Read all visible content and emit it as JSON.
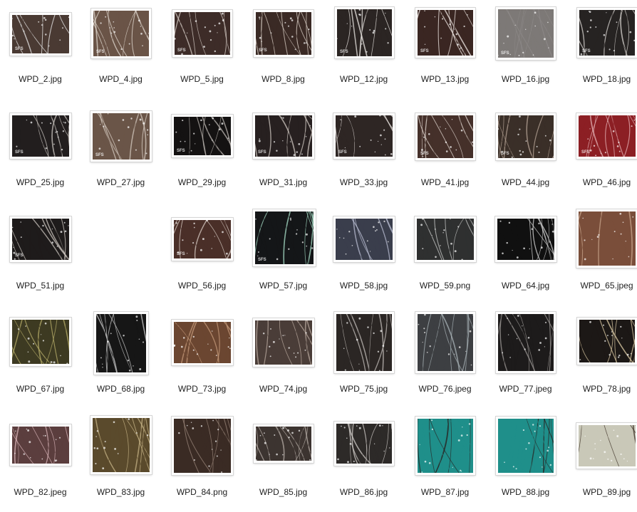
{
  "files": [
    {
      "name": "WPD_2.jpg",
      "watermark": "SFS",
      "base": "#4a3a33",
      "hi": "#e8e8e8"
    },
    {
      "name": "WPD_4.jpg",
      "watermark": "SFS",
      "base": "#6a5447",
      "hi": "#e2dad0"
    },
    {
      "name": "WPD_5.jpg",
      "watermark": "SFS",
      "base": "#3d2c28",
      "hi": "#d8cfc8"
    },
    {
      "name": "WPD_8.jpg",
      "watermark": "SFS",
      "base": "#3a2a25",
      "hi": "#e0d6cc"
    },
    {
      "name": "WPD_12.jpg",
      "watermark": "SFS",
      "base": "#2b2523",
      "hi": "#ece8e4"
    },
    {
      "name": "WPD_13.jpg",
      "watermark": "SFS",
      "base": "#3a2622",
      "hi": "#f0e8e4"
    },
    {
      "name": "WPD_16.jpg",
      "watermark": "SFS",
      "base": "#7d7977",
      "hi": "#8e8a88"
    },
    {
      "name": "WPD_18.jpg",
      "watermark": "SFS",
      "base": "#262322",
      "hi": "#d9d6d2"
    },
    {
      "name": "WPD_25.jpg",
      "watermark": "SFS",
      "base": "#221e1e",
      "hi": "#cfc9c4"
    },
    {
      "name": "WPD_27.jpg",
      "watermark": "SFS",
      "base": "#6a5548",
      "hi": "#d6cbc0"
    },
    {
      "name": "WPD_29.jpg",
      "watermark": "SFS",
      "base": "#141212",
      "hi": "#bfbab4"
    },
    {
      "name": "WPD_31.jpg",
      "watermark": "SFS",
      "base": "#272020",
      "hi": "#d0c8c2"
    },
    {
      "name": "WPD_33.jpg",
      "watermark": "SFS",
      "base": "#2e2624",
      "hi": "#e6e0dc"
    },
    {
      "name": "WPD_41.jpg",
      "watermark": "SFS",
      "base": "#45302a",
      "hi": "#e4dbd4"
    },
    {
      "name": "WPD_44.jpg",
      "watermark": "SFS",
      "base": "#3a2f28",
      "hi": "#bba89a"
    },
    {
      "name": "WPD_46.jpg",
      "watermark": "SFS",
      "base": "#8c1f24",
      "hi": "#e6b6b8"
    },
    {
      "name": "WPD_51.jpg",
      "watermark": "SFS",
      "base": "#1e1b1b",
      "hi": "#cfc8c2"
    },
    {
      "name": "WPD_56.jpg",
      "watermark": "SFS",
      "base": "#4a2f28",
      "hi": "#d8ccc4"
    },
    {
      "name": "WPD_57.jpg",
      "watermark": "SFS",
      "base": "#141618",
      "hi": "#a9e2c9"
    },
    {
      "name": "WPD_58.jpg",
      "watermark": "",
      "base": "#3a3e4c",
      "hi": "#b8bcd0"
    },
    {
      "name": "WPD_59.png",
      "watermark": "",
      "base": "#2f3030",
      "hi": "#c8cac8"
    },
    {
      "name": "WPD_64.jpg",
      "watermark": "",
      "base": "#101010",
      "hi": "#dcdcdc"
    },
    {
      "name": "WPD_65.jpeg",
      "watermark": "",
      "base": "#7a4e3a",
      "hi": "#caa58c"
    },
    {
      "name": "WPD_67.jpg",
      "watermark": "",
      "base": "#3d3a22",
      "hi": "#b7ad6a"
    },
    {
      "name": "WPD_68.jpg",
      "watermark": "",
      "base": "#161616",
      "hi": "#cfcfcf"
    },
    {
      "name": "WPD_73.jpg",
      "watermark": "",
      "base": "#6b4631",
      "hi": "#c49a7a"
    },
    {
      "name": "WPD_74.jpg",
      "watermark": "",
      "base": "#4a3d38",
      "hi": "#b9a99f"
    },
    {
      "name": "WPD_75.jpg",
      "watermark": "",
      "base": "#2b2624",
      "hi": "#c4bfbb"
    },
    {
      "name": "WPD_76.jpeg",
      "watermark": "",
      "base": "#3d3f42",
      "hi": "#aab4b8"
    },
    {
      "name": "WPD_77.jpeg",
      "watermark": "",
      "base": "#1d1b1b",
      "hi": "#9e9a97"
    },
    {
      "name": "WPD_78.jpg",
      "watermark": "",
      "base": "#1c1816",
      "hi": "#e0cfa8"
    },
    {
      "name": "WPD_82.jpeg",
      "watermark": "",
      "base": "#5b3e3e",
      "hi": "#d9b5b9"
    },
    {
      "name": "WPD_83.jpg",
      "watermark": "",
      "base": "#5a4a2c",
      "hi": "#c6b386"
    },
    {
      "name": "WPD_84.png",
      "watermark": "",
      "base": "#3a2b24",
      "hi": "#9a8679"
    },
    {
      "name": "WPD_85.jpg",
      "watermark": "",
      "base": "#3c3430",
      "hi": "#b5aca6"
    },
    {
      "name": "WPD_86.jpg",
      "watermark": "",
      "base": "#2d2a28",
      "hi": "#d4d0cc"
    },
    {
      "name": "WPD_87.jpg",
      "watermark": "",
      "base": "#1f8f8a",
      "hi": "#2a2220"
    },
    {
      "name": "WPD_88.jpg",
      "watermark": "",
      "base": "#1f8f8a",
      "hi": "#2a2220"
    },
    {
      "name": "WPD_89.jpg",
      "watermark": "",
      "base": "#c9c8b8",
      "hi": "#3b2f24"
    }
  ]
}
